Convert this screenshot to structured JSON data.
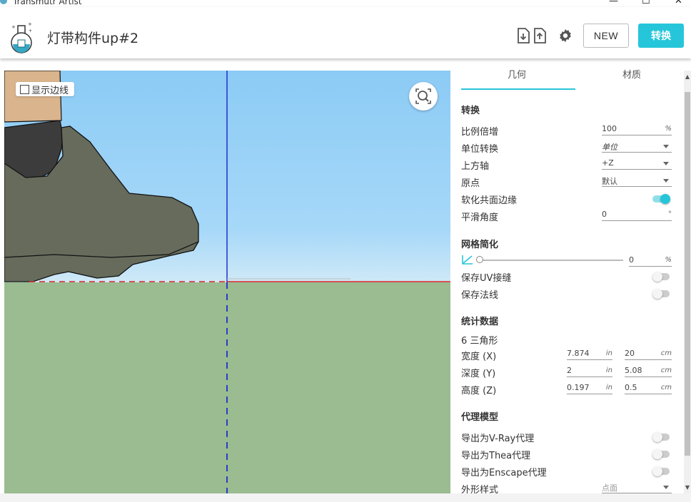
{
  "window": {
    "title": "Transmutr Artist",
    "minimize": "—",
    "maximize": "☐",
    "close": "✕"
  },
  "header": {
    "doc_title": "灯带构件up#2",
    "new_label": "NEW",
    "convert_label": "转换"
  },
  "viewport": {
    "show_edges_label": "显示边线"
  },
  "panel": {
    "tabs": [
      "几何",
      "材质"
    ],
    "transform": {
      "title": "转换",
      "scale_label": "比例倍增",
      "scale_value": "100",
      "scale_unit": "%",
      "unit_label": "单位转换",
      "unit_value": "单位",
      "up_axis_label": "上方轴",
      "up_axis_value": "+Z",
      "origin_label": "原点",
      "origin_value": "默认",
      "soften_label": "软化共面边缘",
      "soften_on": true,
      "smooth_label": "平滑角度",
      "smooth_value": "0",
      "smooth_unit": "°"
    },
    "mesh": {
      "title": "网格简化",
      "value": "0",
      "unit": "%",
      "uv_label": "保存UV接缝",
      "uv_on": false,
      "normals_label": "保存法线",
      "normals_on": false
    },
    "stats": {
      "title": "统计数据",
      "triangles": "6 三角形",
      "width_label": "宽度 (X)",
      "width_in": "7.874",
      "width_cm": "20",
      "depth_label": "深度 (Y)",
      "depth_in": "2",
      "depth_cm": "5.08",
      "height_label": "高度 (Z)",
      "height_in": "0.197",
      "height_cm": "0.5",
      "unit_in": "in",
      "unit_cm": "cm"
    },
    "proxy": {
      "title": "代理模型",
      "vray_label": "导出为V-Ray代理",
      "vray_on": false,
      "thea_label": "导出为Thea代理",
      "thea_on": false,
      "enscape_label": "导出为Enscape代理",
      "enscape_on": false,
      "display_label": "外形样式",
      "display_value": "点面"
    }
  },
  "colors": {
    "accent": "#26c6da",
    "sky_top": "#90cdf4",
    "ground": "#9abc90",
    "shoe": "#666b5c"
  }
}
